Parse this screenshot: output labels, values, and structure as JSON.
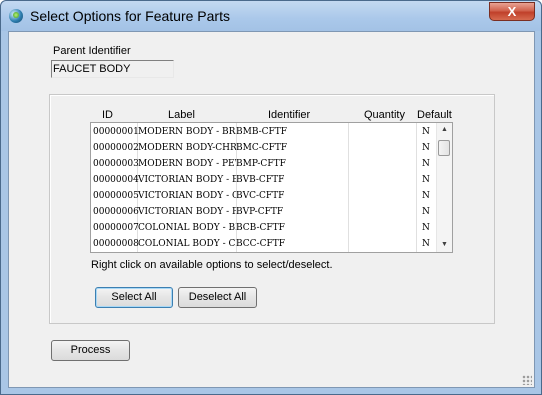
{
  "window": {
    "title": "Select Options for Feature Parts",
    "close_glyph": "X"
  },
  "parent": {
    "label": "Parent Identifier",
    "value": "FAUCET BODY"
  },
  "table": {
    "headers": {
      "id": "ID",
      "label": "Label",
      "identifier": "Identifier",
      "quantity": "Quantity",
      "default": "Default"
    },
    "rows": [
      {
        "id": "00000001",
        "label": "MODERN BODY - BR",
        "identifier": "BMB-CFTF",
        "quantity": "",
        "default": "N"
      },
      {
        "id": "00000002",
        "label": "MODERN BODY-CHR",
        "identifier": "BMC-CFTF",
        "quantity": "",
        "default": "N"
      },
      {
        "id": "00000003",
        "label": "MODERN BODY - PEW",
        "identifier": "BMP-CFTF",
        "quantity": "",
        "default": "N"
      },
      {
        "id": "00000004",
        "label": "VICTORIAN BODY - B",
        "identifier": "BVB-CFTF",
        "quantity": "",
        "default": "N"
      },
      {
        "id": "00000005",
        "label": "VICTORIAN BODY - C",
        "identifier": "BVC-CFTF",
        "quantity": "",
        "default": "N"
      },
      {
        "id": "00000006",
        "label": "VICTORIAN BODY - P",
        "identifier": "BVP-CFTF",
        "quantity": "",
        "default": "N"
      },
      {
        "id": "00000007",
        "label": "COLONIAL BODY - BI",
        "identifier": "BCB-CFTF",
        "quantity": "",
        "default": "N"
      },
      {
        "id": "00000008",
        "label": "COLONIAL BODY - CH",
        "identifier": "BCC-CFTF",
        "quantity": "",
        "default": "N"
      }
    ],
    "scroll_up": "▲",
    "scroll_down": "▼"
  },
  "hint": "Right click on available options to select/deselect.",
  "buttons": {
    "select_all": "Select All",
    "deselect_all": "Deselect All",
    "process": "Process"
  }
}
